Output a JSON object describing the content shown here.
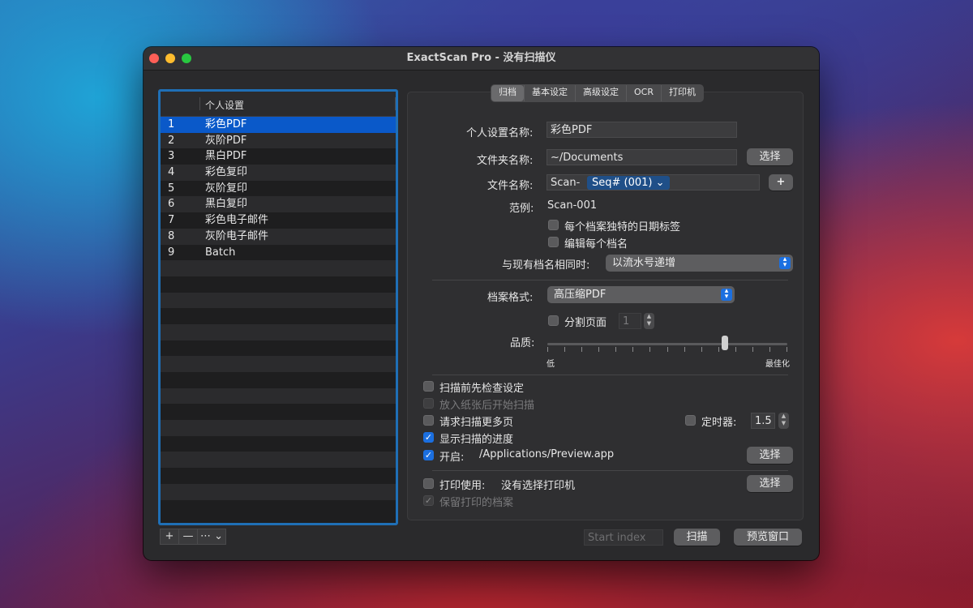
{
  "window": {
    "title": "ExactScan Pro - 没有扫描仪"
  },
  "list": {
    "header": "个人设置",
    "rows": [
      {
        "num": "1",
        "name": "彩色PDF"
      },
      {
        "num": "2",
        "name": "灰阶PDF"
      },
      {
        "num": "3",
        "name": "黑白PDF"
      },
      {
        "num": "4",
        "name": "彩色复印"
      },
      {
        "num": "5",
        "name": "灰阶复印"
      },
      {
        "num": "6",
        "name": "黑白复印"
      },
      {
        "num": "7",
        "name": "彩色电子邮件"
      },
      {
        "num": "8",
        "name": "灰阶电子邮件"
      },
      {
        "num": "9",
        "name": "Batch"
      }
    ],
    "selected_index": 0,
    "tools": {
      "add": "+",
      "remove": "—",
      "more": "⋯ ⌄"
    }
  },
  "tabs": [
    "归档",
    "基本设定",
    "高级设定",
    "OCR",
    "打印机"
  ],
  "active_tab": "归档",
  "form": {
    "profile_name_label": "个人设置名称:",
    "profile_name_value": "彩色PDF",
    "folder_label": "文件夹名称:",
    "folder_value": "~/Documents",
    "folder_choose": "选择",
    "filename_label": "文件名称:",
    "filename_prefix": "Scan-",
    "filename_token": "Seq# (001) ⌄",
    "filename_add": "+",
    "example_label": "范例:",
    "example_value": "Scan-001",
    "unique_date_label": "每个档案独特的日期标签",
    "edit_each_label": "编辑每个档名",
    "conflict_label": "与现有档名相同时:",
    "conflict_value": "以流水号递增",
    "format_label": "档案格式:",
    "format_value": "高压缩PDF",
    "split_label": "分割页面",
    "split_value": "1",
    "quality_label": "品质:",
    "quality_low": "低",
    "quality_high": "最佳化",
    "quality_level": 0.74,
    "check_before_label": "扫描前先检查设定",
    "start_after_paper_label": "放入纸张后开始扫描",
    "request_more_label": "请求扫描更多页",
    "timer_label": "定时器:",
    "timer_value": "1.5",
    "show_progress_label": "显示扫描的进度",
    "open_label": "开启:",
    "open_value": "/Applications/Preview.app",
    "open_choose": "选择",
    "print_label": "打印使用:",
    "print_value": "没有选择打印机",
    "print_choose": "选择",
    "keep_printed_label": "保留打印的档案"
  },
  "footer": {
    "start_index_placeholder": "Start index",
    "scan_button": "扫描",
    "preview_button": "预览窗口"
  },
  "colors": {
    "accent": "#1b6fe0",
    "selection": "#0a59c9",
    "list_border": "#1f6fb6"
  }
}
